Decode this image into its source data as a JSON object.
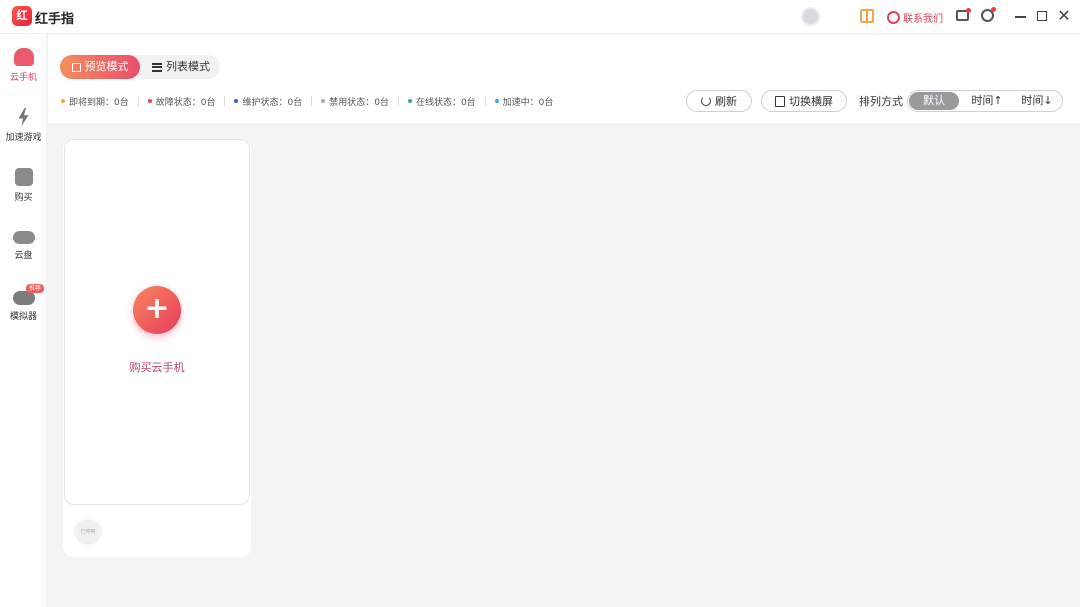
{
  "app": {
    "title": "红手指",
    "logo_text": "红"
  },
  "titlebar": {
    "contact_label": "联系我们"
  },
  "sidebar": {
    "items": [
      {
        "label": "云手机",
        "icon": "cloud-phone-icon"
      },
      {
        "label": "加速游戏",
        "icon": "bolt-icon"
      },
      {
        "label": "购买",
        "icon": "shopping-bag-icon"
      },
      {
        "label": "云盘",
        "icon": "cloud-icon"
      },
      {
        "label": "模拟器",
        "icon": "gamepad-icon",
        "badge": "推荐"
      }
    ]
  },
  "modes": {
    "preview": "预览模式",
    "list": "列表模式"
  },
  "status": [
    {
      "label": "即将到期：0台",
      "color": "#f0a63b"
    },
    {
      "label": "故障状态：0台",
      "color": "#e84a4a"
    },
    {
      "label": "维护状态：0台",
      "color": "#3a62c9"
    },
    {
      "label": "禁用状态：0台",
      "color": "#a9a9a9"
    },
    {
      "label": "在线状态：0台",
      "color": "#2fb07a"
    },
    {
      "label": "加速中：0台",
      "color": "#3fa4d8"
    }
  ],
  "actions": {
    "refresh": "刷新",
    "rotate": "切换横屏"
  },
  "sort": {
    "label": "排列方式",
    "options": [
      "默认",
      "时间↑",
      "时间↓"
    ]
  },
  "card": {
    "title": "购买云手机",
    "plus": "+",
    "badge": "已停用"
  },
  "colors": {
    "accent": "#e83b5e",
    "accent_light": "#f7865a"
  }
}
